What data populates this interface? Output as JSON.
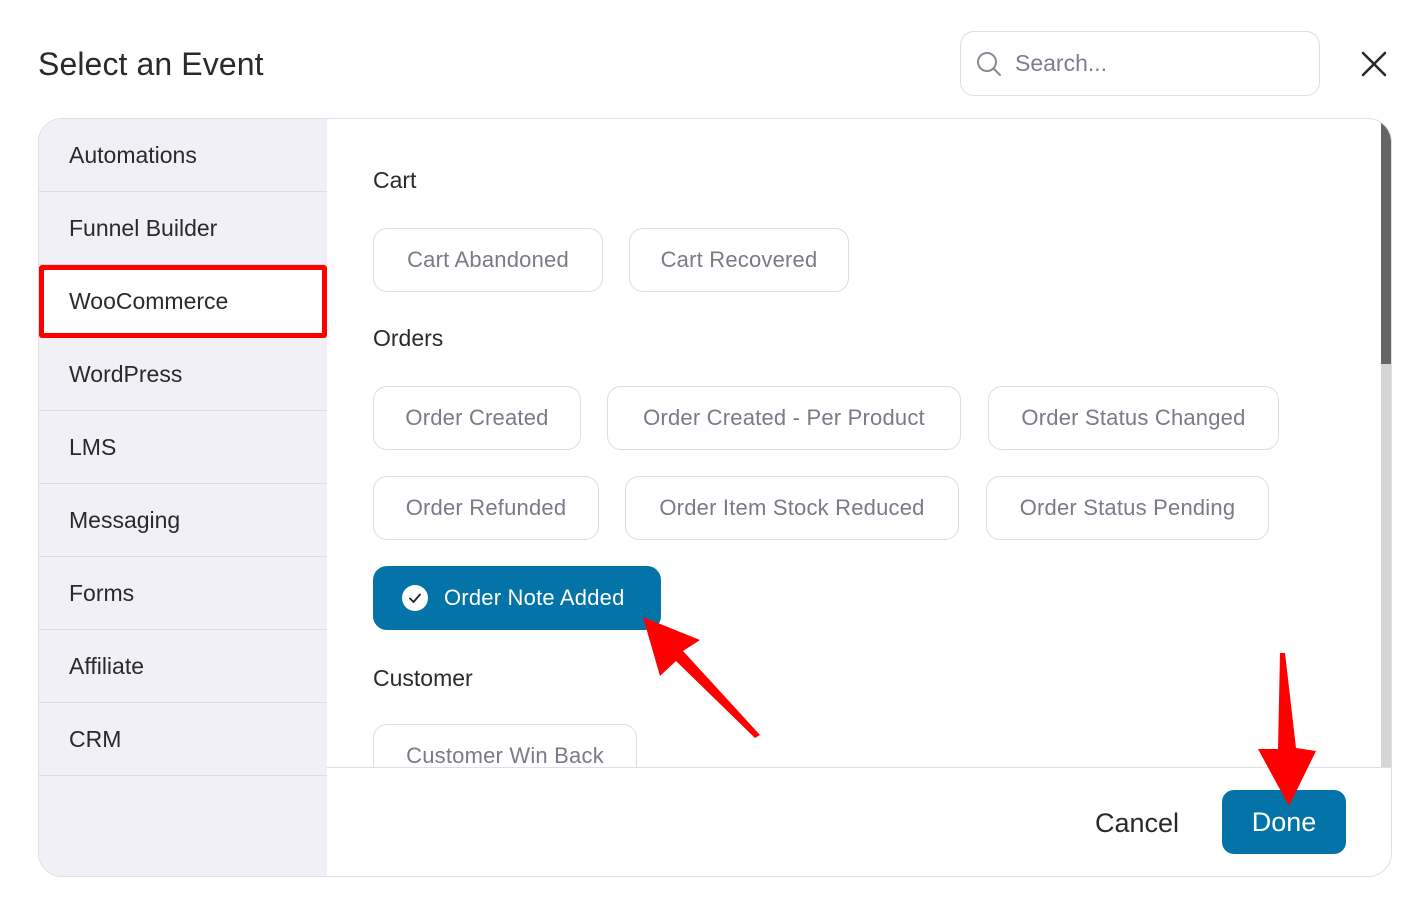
{
  "header": {
    "title": "Select an Event",
    "search_placeholder": "Search...",
    "search_value": ""
  },
  "sidebar": {
    "items": [
      {
        "label": "Automations"
      },
      {
        "label": "Funnel Builder"
      },
      {
        "label": "WooCommerce",
        "active": true
      },
      {
        "label": "WordPress"
      },
      {
        "label": "LMS"
      },
      {
        "label": "Messaging"
      },
      {
        "label": "Forms"
      },
      {
        "label": "Affiliate"
      },
      {
        "label": "CRM"
      }
    ]
  },
  "content": {
    "sections": [
      {
        "title": "Cart",
        "events": [
          "Cart Abandoned",
          "Cart Recovered"
        ]
      },
      {
        "title": "Orders",
        "events": [
          "Order Created",
          "Order Created - Per Product",
          "Order Status Changed",
          "Order Refunded",
          "Order Item Stock Reduced",
          "Order Status Pending",
          "Order Note Added"
        ],
        "selected": "Order Note Added"
      },
      {
        "title": "Customer",
        "events": [
          "Customer Win Back"
        ]
      }
    ],
    "scroll_position": 0
  },
  "footer": {
    "cancel_label": "Cancel",
    "done_label": "Done"
  },
  "colors": {
    "primary": "#0473a8",
    "highlight": "#ff0000",
    "sidebar_bg": "#f0f0f6",
    "chip_text": "#7a7a88"
  }
}
